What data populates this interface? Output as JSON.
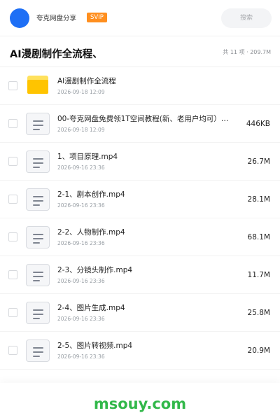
{
  "header": {
    "share_name": "夸克网盘分享",
    "badge": "SVIP",
    "search_placeholder": "搜索"
  },
  "folder": {
    "title": "AI漫剧制作全流程、",
    "summary": "共 11 项 · 209.7M"
  },
  "files": [
    {
      "type": "folder",
      "name": "AI漫剧制作全流程",
      "date": "2026-09-18 12:09",
      "size": ""
    },
    {
      "type": "file",
      "name": "00-夸克网盘免费领1T空间教程(新、老用户均可）…",
      "date": "2026-09-18 12:09",
      "size": "446KB"
    },
    {
      "type": "file",
      "name": "1、项目原理.mp4",
      "date": "2026-09-16 23:36",
      "size": "26.7M"
    },
    {
      "type": "file",
      "name": "2-1、剧本创作.mp4",
      "date": "2026-09-16 23:36",
      "size": "28.1M"
    },
    {
      "type": "file",
      "name": "2-2、人物制作.mp4",
      "date": "2026-09-16 23:36",
      "size": "68.1M"
    },
    {
      "type": "file",
      "name": "2-3、分镜头制作.mp4",
      "date": "2026-09-16 23:36",
      "size": "11.7M"
    },
    {
      "type": "file",
      "name": "2-4、图片生成.mp4",
      "date": "2026-09-16 23:36",
      "size": "25.8M"
    },
    {
      "type": "file",
      "name": "2-5、图片转视频.mp4",
      "date": "2026-09-16 23:36",
      "size": "20.9M"
    }
  ],
  "watermark": "msouy.com",
  "colors": {
    "avatar": "#1e6ff5",
    "svip": "#ff8f1f",
    "folder": "#ffc400",
    "watermark": "#32b84a"
  },
  "icons": {
    "folder": "folder-icon",
    "file": "document-icon",
    "checkbox": "checkbox-icon"
  }
}
